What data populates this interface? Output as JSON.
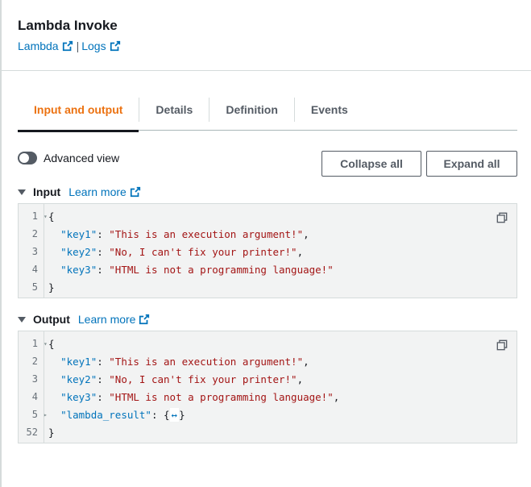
{
  "header": {
    "title": "Lambda Invoke",
    "links": [
      {
        "label": "Lambda",
        "icon": "external-link-icon"
      },
      {
        "label": "Logs",
        "icon": "external-link-icon"
      }
    ],
    "separator": "|"
  },
  "tabs": [
    {
      "label": "Input and output",
      "active": true
    },
    {
      "label": "Details",
      "active": false
    },
    {
      "label": "Definition",
      "active": false
    },
    {
      "label": "Events",
      "active": false
    }
  ],
  "toolbar": {
    "advanced_view_label": "Advanced view",
    "advanced_view_on": false,
    "collapse_all_label": "Collapse all",
    "expand_all_label": "Expand all"
  },
  "input": {
    "title": "Input",
    "learn_more": "Learn more",
    "lines": [
      {
        "num": "1",
        "fold": "▾",
        "text": "{"
      },
      {
        "num": "2",
        "fold": "",
        "key": "\"key1\"",
        "value": "\"This is an execution argument!\"",
        "trail": ","
      },
      {
        "num": "3",
        "fold": "",
        "key": "\"key2\"",
        "value": "\"No, I can't fix your printer!\"",
        "trail": ","
      },
      {
        "num": "4",
        "fold": "",
        "key": "\"key3\"",
        "value": "\"HTML is not a programming language!\"",
        "trail": ""
      },
      {
        "num": "5",
        "fold": "",
        "text": "}"
      }
    ]
  },
  "output": {
    "title": "Output",
    "learn_more": "Learn more",
    "lines": [
      {
        "num": "1",
        "fold": "▾",
        "text": "{"
      },
      {
        "num": "2",
        "fold": "",
        "key": "\"key1\"",
        "value": "\"This is an execution argument!\"",
        "trail": ","
      },
      {
        "num": "3",
        "fold": "",
        "key": "\"key2\"",
        "value": "\"No, I can't fix your printer!\"",
        "trail": ","
      },
      {
        "num": "4",
        "fold": "",
        "key": "\"key3\"",
        "value": "\"HTML is not a programming language!\"",
        "trail": ","
      },
      {
        "num": "5",
        "fold": "▸",
        "key": "\"lambda_result\"",
        "collapsed": "↔",
        "trail": ""
      },
      {
        "num": "52",
        "fold": "",
        "text": "}"
      }
    ]
  },
  "colors": {
    "accent": "#ec7211",
    "link": "#0073bb",
    "string": "#a31515"
  }
}
